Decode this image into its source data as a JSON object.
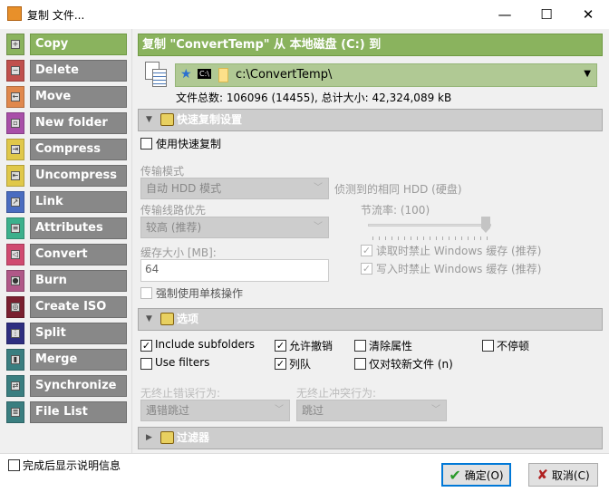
{
  "window": {
    "title": "复制 文件...",
    "minimize": "—",
    "maximize": "☐",
    "close": "✕"
  },
  "sidebar": {
    "items": [
      {
        "label": "Copy",
        "color": "#8ab35e",
        "icon": "plus-icon",
        "glyph": "+"
      },
      {
        "label": "Delete",
        "color": "#c0504d",
        "icon": "minus-icon",
        "glyph": "−"
      },
      {
        "label": "Move",
        "color": "#e0884d",
        "icon": "arrow-left-icon",
        "glyph": "←"
      },
      {
        "label": "New folder",
        "color": "#a84fa8",
        "icon": "folder-icon",
        "glyph": "▫"
      },
      {
        "label": "Compress",
        "color": "#e0c84a",
        "icon": "compress-icon",
        "glyph": "⇥"
      },
      {
        "label": "Uncompress",
        "color": "#e0c84a",
        "icon": "uncompress-icon",
        "glyph": "⇤"
      },
      {
        "label": "Link",
        "color": "#4a6cc0",
        "icon": "link-icon",
        "glyph": "↗"
      },
      {
        "label": "Attributes",
        "color": "#3cb08c",
        "icon": "list-icon",
        "glyph": "≡"
      },
      {
        "label": "Convert",
        "color": "#d04a70",
        "icon": "convert-icon",
        "glyph": "◁"
      },
      {
        "label": "Burn",
        "color": "#b05888",
        "icon": "disc-icon",
        "glyph": "●"
      },
      {
        "label": "Create ISO",
        "color": "#7a2030",
        "icon": "iso-icon",
        "glyph": "◎"
      },
      {
        "label": "Split",
        "color": "#2e2e80",
        "icon": "split-icon",
        "glyph": "⋮"
      },
      {
        "label": "Merge",
        "color": "#3a7e80",
        "icon": "merge-icon",
        "glyph": "▮"
      },
      {
        "label": "Synchronize",
        "color": "#3a7e80",
        "icon": "sync-icon",
        "glyph": "⇄"
      },
      {
        "label": "File List",
        "color": "#3a7e80",
        "icon": "file-list-icon",
        "glyph": "≣"
      }
    ]
  },
  "main": {
    "header": "复制 \"ConvertTemp\" 从 本地磁盘 (C:) 到",
    "path": "c:\\ConvertTemp\\",
    "drive_badge": "C:\\",
    "file_info": "文件总数: 106096 (14455), 总计大小: 42,324,089 kB",
    "quick": {
      "title": "快速复制设置",
      "use_fast": "使用快速复制",
      "mode_label": "传输模式",
      "mode_value": "自动 HDD 模式",
      "detected": "侦测到的相同 HDD (硬盘)",
      "priority_label": "传输线路优先",
      "priority_value": "较高 (推荐)",
      "throttle_label": "节流率: (100)",
      "throttle_value": 100,
      "cache_label": "缓存大小 [MB]:",
      "cache_value": "64",
      "read_cache": "读取时禁止 Windows 缓存 (推荐)",
      "write_cache": "写入时禁止 Windows 缓存 (推荐)",
      "single_core": "强制使用单核操作"
    },
    "options": {
      "title": "选项",
      "include_subfolders": "Include subfolders",
      "use_filters": "Use filters",
      "allow_undo": "允许撤销",
      "queue": "列队",
      "clear_attr": "清除属性",
      "newer_only": "仅对较新文件 (n)",
      "no_pause": "不停顿",
      "error_label": "无终止错误行为:",
      "error_value": "遇错跳过",
      "conflict_label": "无终止冲突行为:",
      "conflict_value": "跳过"
    },
    "filters": {
      "title": "过滤器"
    }
  },
  "footer": {
    "show_info": "完成后显示说明信息",
    "ok": "确定(O)",
    "cancel": "取消(C)"
  }
}
